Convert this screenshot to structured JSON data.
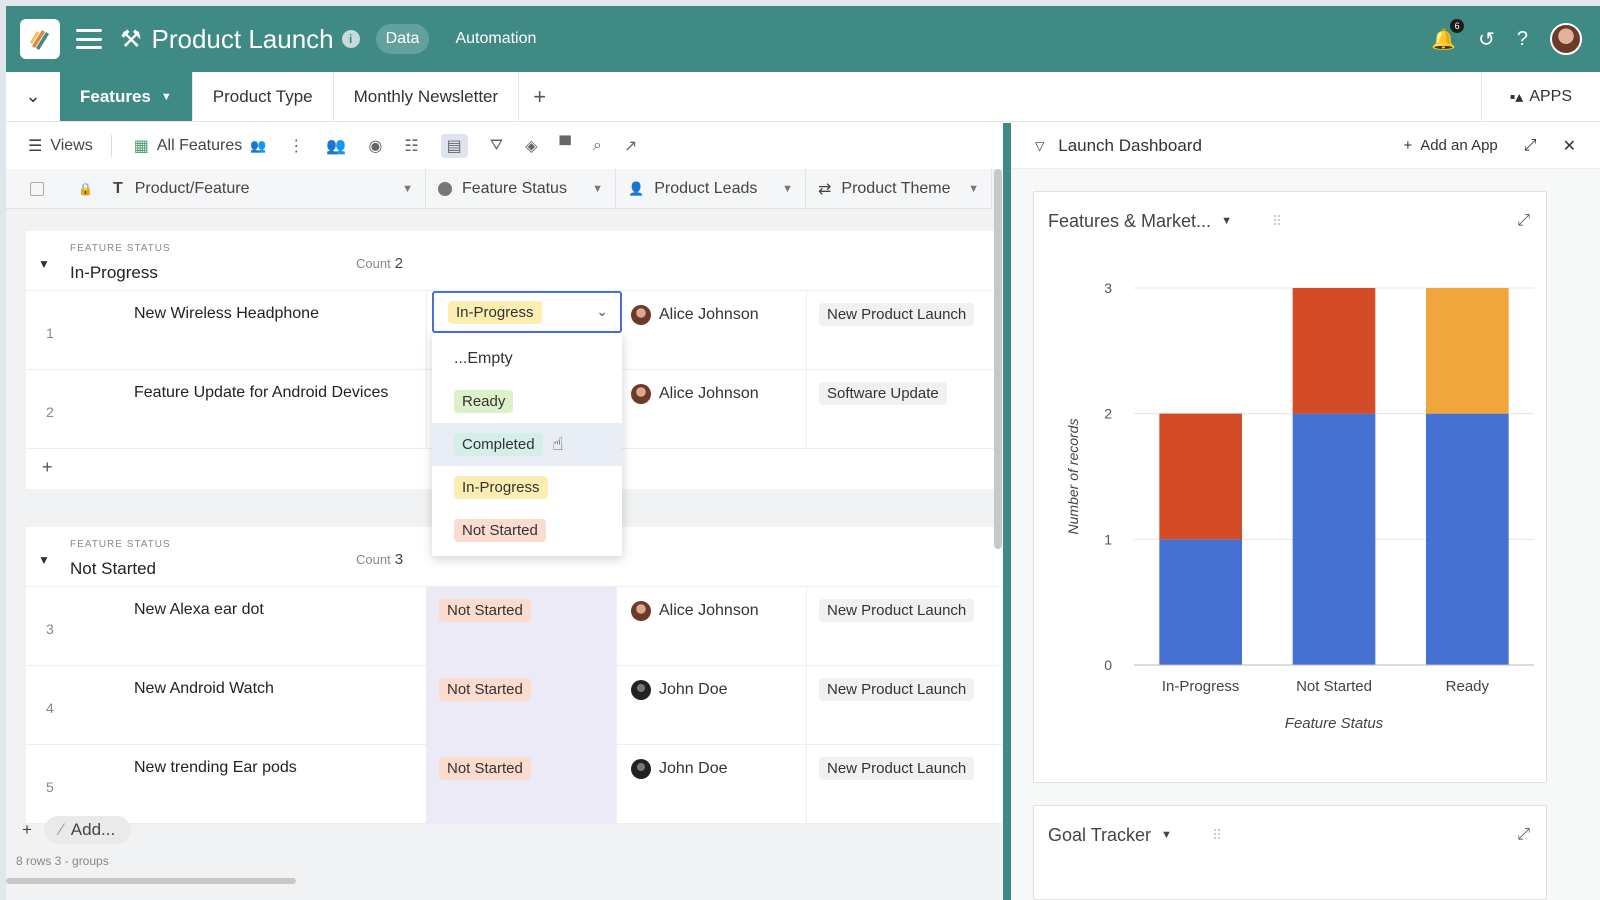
{
  "header": {
    "title": "Product Launch",
    "tabs": [
      "Data",
      "Automation"
    ],
    "notification_count": "6",
    "brand_color": "#3f8a84"
  },
  "tabsbar": {
    "tabs": [
      "Features",
      "Product Type",
      "Monthly Newsletter"
    ],
    "apps_label": "APPS"
  },
  "toolbar": {
    "views_label": "Views",
    "view_name": "All Features"
  },
  "columns": {
    "name": "Product/Feature",
    "status": "Feature Status",
    "leads": "Product Leads",
    "theme": "Product Theme"
  },
  "groups": [
    {
      "label": "FEATURE STATUS",
      "value": "In-Progress",
      "count_label": "Count",
      "count": "2",
      "rows": [
        {
          "num": "1",
          "name": "New Wireless Headphone",
          "status": "In-Progress",
          "lead": "Alice Johnson",
          "theme": "New Product Launch"
        },
        {
          "num": "2",
          "name": "Feature Update for Android Devices",
          "status": "",
          "lead": "Alice Johnson",
          "theme": "Software Update"
        }
      ]
    },
    {
      "label": "FEATURE STATUS",
      "value": "Not Started",
      "count_label": "Count",
      "count": "3",
      "rows": [
        {
          "num": "3",
          "name": "New Alexa ear dot",
          "status": "Not Started",
          "lead": "Alice Johnson",
          "theme": "New Product Launch"
        },
        {
          "num": "4",
          "name": "New Android Watch",
          "status": "Not Started",
          "lead": "John Doe",
          "theme": "New Product Launch"
        },
        {
          "num": "5",
          "name": "New trending Ear pods",
          "status": "Not Started",
          "lead": "John Doe",
          "theme": "New Product Launch"
        }
      ]
    }
  ],
  "dropdown": {
    "selected": "In-Progress",
    "options": [
      "...Empty",
      "Ready",
      "Completed",
      "In-Progress",
      "Not Started"
    ]
  },
  "footer": {
    "add_label": "Add...",
    "rows_summary": "8 rows   3 - groups"
  },
  "panel": {
    "title": "Launch Dashboard",
    "add_app_label": "Add an App",
    "chart_card_title": "Features & Market...",
    "goal_card_title": "Goal Tracker"
  },
  "colors": {
    "blue": "#4471d2",
    "red": "#d34b27",
    "orange": "#f0a63c"
  },
  "chart_data": {
    "type": "bar",
    "stacked": true,
    "categories": [
      "In-Progress",
      "Not Started",
      "Ready"
    ],
    "series": [
      {
        "values": [
          1,
          2,
          2
        ],
        "color": "#4471d2"
      },
      {
        "values": [
          1,
          1,
          0
        ],
        "color": "#d34b27"
      },
      {
        "values": [
          0,
          0,
          1
        ],
        "color": "#f0a63c"
      }
    ],
    "xlabel": "Feature Status",
    "ylabel": "Number of records",
    "ylim": [
      0,
      3
    ],
    "yticks": [
      0,
      1,
      2,
      3
    ],
    "grid": true
  }
}
